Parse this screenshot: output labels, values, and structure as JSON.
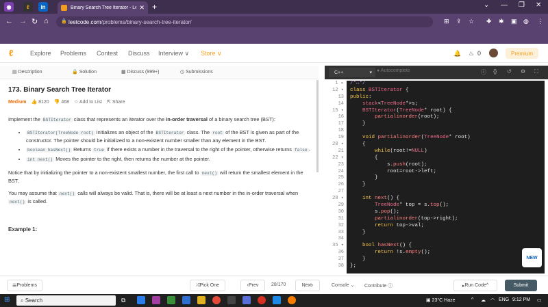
{
  "browser": {
    "tab_title": "Binary Search Tree Iterator - Lee",
    "url_host": "leetcode.com",
    "url_path": "/problems/binary-search-tree-iterator/"
  },
  "nav": {
    "items": [
      "Explore",
      "Problems",
      "Contest",
      "Discuss",
      "Interview ∨",
      "Store ∨"
    ],
    "notif_count": "0",
    "premium": "Premium"
  },
  "left_tabs": [
    "Description",
    "Solution",
    "Discuss (999+)",
    "Submissions"
  ],
  "problem": {
    "title": "173. Binary Search Tree Iterator",
    "difficulty": "Medium",
    "likes": "8120",
    "dislikes": "468",
    "add_to_list": "Add to List",
    "share": "Share",
    "intro_pre": "Implement the ",
    "intro_code": "BSTIterator",
    "intro_mid": " class that represents an iterator over the ",
    "intro_bold": "in-order traversal",
    "intro_post": " of a binary search tree (BST):",
    "b1_code": "BSTIterator(TreeNode root)",
    "b1_a": " Initializes an object of the ",
    "b1_code2": "BSTIterator",
    "b1_b": " class. The ",
    "b1_code3": "root",
    "b1_c": " of the BST is given as part of the constructor. The pointer should be initialized to a non-existent number smaller than any element in the BST.",
    "b2_code": "boolean hasNext()",
    "b2_a": " Returns ",
    "b2_code2": "true",
    "b2_b": " if there exists a number in the traversal to the right of the pointer, otherwise returns ",
    "b2_code3": "false",
    "b2_c": ".",
    "b3_code": "int next()",
    "b3_a": " Moves the pointer to the right, then returns the number at the pointer.",
    "p2_a": "Notice that by initializing the pointer to a non-existent smallest number, the first call to ",
    "p2_code": "next()",
    "p2_b": " will return the smallest element in the BST.",
    "p3_a": "You may assume that ",
    "p3_code": "next()",
    "p3_b": " calls will always be valid. That is, there will be at least a next number in the in-order traversal when ",
    "p3_code2": "next()",
    "p3_c": " is called.",
    "example": "Example 1:"
  },
  "editor": {
    "language": "C++",
    "autocomplete": "Autocomplete",
    "line_numbers": [
      "1 ▸",
      "12 ▾",
      "13",
      "14",
      "15 ▾",
      "16",
      "17",
      "18",
      "19",
      "20 ▾",
      "21",
      "22 ▾",
      "23",
      "24",
      "25",
      "26",
      "27",
      "28 ▾",
      "29",
      "30",
      "31",
      "32",
      "33",
      "34",
      "35 ▾",
      "36",
      "37",
      "38"
    ],
    "lines": [
      "/*↔*/",
      "class BSTIterator {",
      "public:",
      "    stack<TreeNode*>s;",
      "    BSTIterator(TreeNode* root) {",
      "        partialinorder(root);",
      "    }",
      "",
      "    void partialinorder(TreeNode* root)",
      "    {",
      "        while(root!=NULL)",
      "        {",
      "            s.push(root);",
      "            root=root->left;",
      "        }",
      "    }",
      "",
      "    int next() {",
      "        TreeNode* top = s.top();",
      "        s.pop();",
      "        partialinorder(top->right);",
      "        return top->val;",
      "    }",
      "",
      "    bool hasNext() {",
      "        return !s.empty();",
      "    }",
      "};"
    ],
    "new_badge": "NEW"
  },
  "bottom": {
    "problems": "Problems",
    "pick_one": "Pick One",
    "prev": "Prev",
    "page": "28/170",
    "next": "Next",
    "console": "Console",
    "contribute": "Contribute",
    "run": "Run Code",
    "submit": "Submit"
  },
  "taskbar": {
    "search": "Search",
    "weather": "23°C  Haze",
    "lang": "ENG",
    "time": "9:12 PM"
  },
  "colors": {
    "leetcode_orange": "#f89f1b",
    "editor_bg": "#1e1e1e",
    "browser_purple": "#5a4270",
    "submit_btn": "#455a64"
  }
}
